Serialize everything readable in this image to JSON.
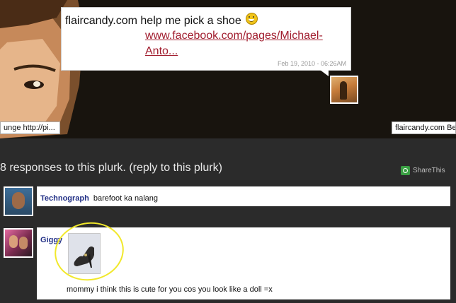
{
  "timeline": {
    "plurk": {
      "message": "flaircandy.com help me pick a shoe",
      "emoji": "grinning-face",
      "link_text": "www.facebook.com/pages/Michael-Anto...",
      "timestamp": "Feb 19, 2010 - 06:26AM"
    },
    "left_tag": "unge http://pi...",
    "right_tag": "flaircandy.com Be"
  },
  "responses": {
    "header": "8 responses to this plurk. (",
    "reply_link": "reply to this plurk",
    "header_close": ")",
    "share_label": "ShareThis",
    "items": [
      {
        "user": "Technograph",
        "text": "barefoot ka nalang"
      },
      {
        "user": "Giggy",
        "text": "mommy i think this is cute for you cos you look like a doll =x"
      }
    ]
  },
  "colors": {
    "background": "#2b2b2b",
    "link_red": "#a11d2e",
    "username_blue": "#233187",
    "highlight_yellow": "#f1e82b"
  }
}
